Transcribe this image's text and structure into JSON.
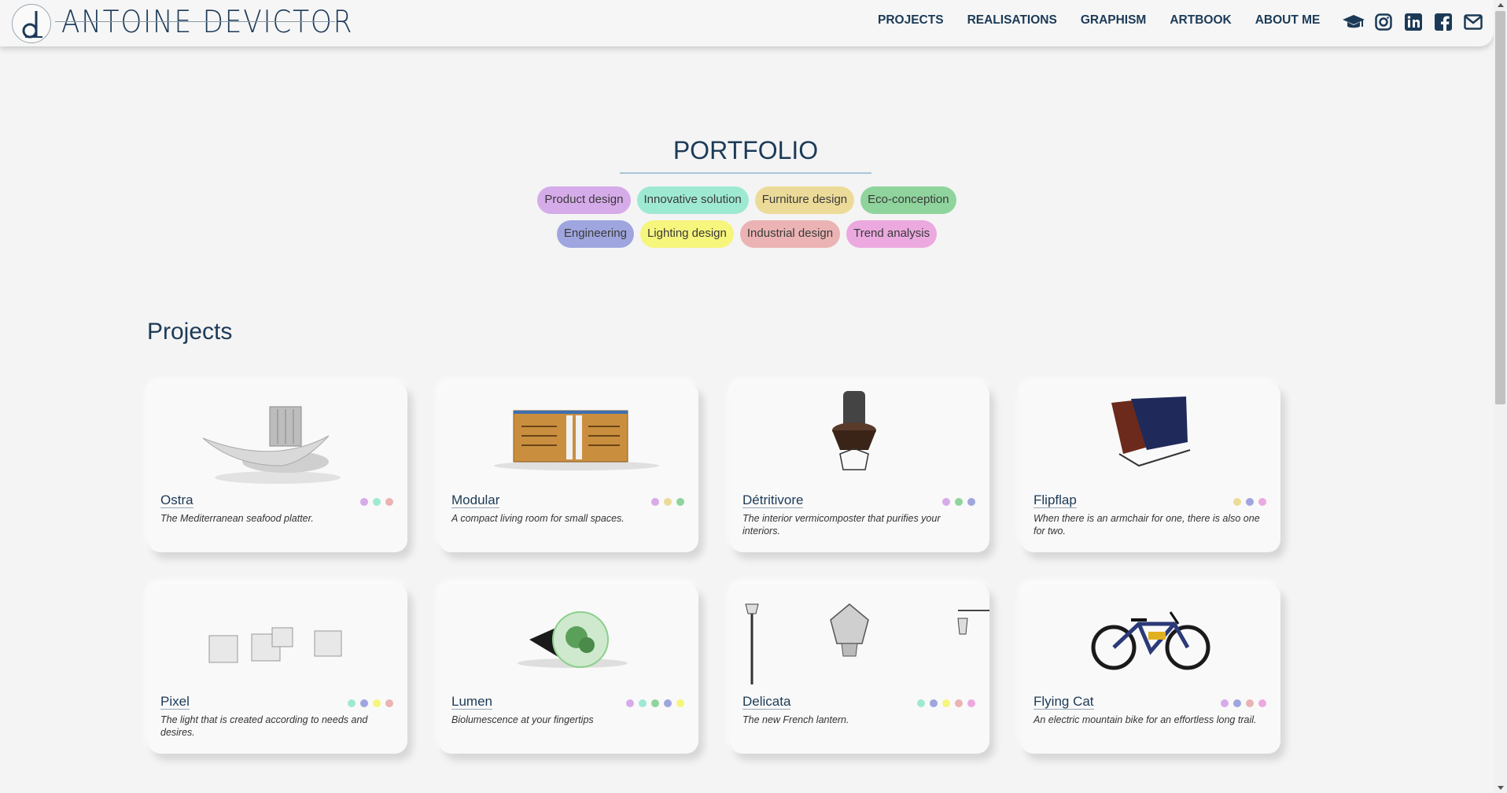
{
  "header": {
    "brand": "ANTOINE DEVICTOR",
    "nav": [
      {
        "label": "PROJECTS"
      },
      {
        "label": "REALISATIONS"
      },
      {
        "label": "GRAPHISM"
      },
      {
        "label": "ARTBOOK"
      },
      {
        "label": "ABOUT ME"
      }
    ],
    "social_icons": [
      "graduation-cap-icon",
      "instagram-icon",
      "linkedin-icon",
      "facebook-icon",
      "mail-icon"
    ]
  },
  "portfolio": {
    "title": "PORTFOLIO",
    "tags_row1": [
      {
        "label": "Product design",
        "color": "#d6abea"
      },
      {
        "label": "Innovative solution",
        "color": "#9ee9d2"
      },
      {
        "label": "Furniture design",
        "color": "#ecdb98"
      },
      {
        "label": "Eco-conception",
        "color": "#8fd49c"
      }
    ],
    "tags_row2": [
      {
        "label": "Engineering",
        "color": "#9fa5de"
      },
      {
        "label": "Lighting design",
        "color": "#f6f57c"
      },
      {
        "label": "Industrial design",
        "color": "#ebb3b3"
      },
      {
        "label": "Trend analysis",
        "color": "#eba9df"
      }
    ]
  },
  "projects": {
    "heading": "Projects",
    "cards": [
      {
        "name": "Ostra",
        "desc": "The Mediterranean seafood platter.",
        "dots": [
          "#d6abea",
          "#9ee9d2",
          "#ebb3b3"
        ]
      },
      {
        "name": "Modular",
        "desc": "A compact living room for small spaces.",
        "dots": [
          "#d6abea",
          "#ecdb98",
          "#8fd49c"
        ]
      },
      {
        "name": "Détritivore",
        "desc": "The interior vermicomposter that purifies your interiors.",
        "dots": [
          "#d6abea",
          "#8fd49c",
          "#9fa5de"
        ]
      },
      {
        "name": "Flipflap",
        "desc": "When there is an armchair for one, there is also one for two.",
        "dots": [
          "#ecdb98",
          "#9fa5de",
          "#eba9df"
        ]
      },
      {
        "name": "Pixel",
        "desc": "The light that is created according to needs and desires.",
        "dots": [
          "#9ee9d2",
          "#9fa5de",
          "#f6f57c",
          "#ebb3b3"
        ]
      },
      {
        "name": "Lumen",
        "desc": "Biolumescence at your fingertips",
        "dots": [
          "#d6abea",
          "#9ee9d2",
          "#8fd49c",
          "#9fa5de",
          "#f6f57c"
        ]
      },
      {
        "name": "Delicata",
        "desc": "The new French lantern.",
        "dots": [
          "#9ee9d2",
          "#9fa5de",
          "#f6f57c",
          "#ebb3b3",
          "#eba9df"
        ]
      },
      {
        "name": "Flying Cat",
        "desc": "An electric mountain bike for an effortless long trail.",
        "dots": [
          "#d6abea",
          "#9fa5de",
          "#ebb3b3",
          "#eba9df"
        ]
      }
    ]
  }
}
